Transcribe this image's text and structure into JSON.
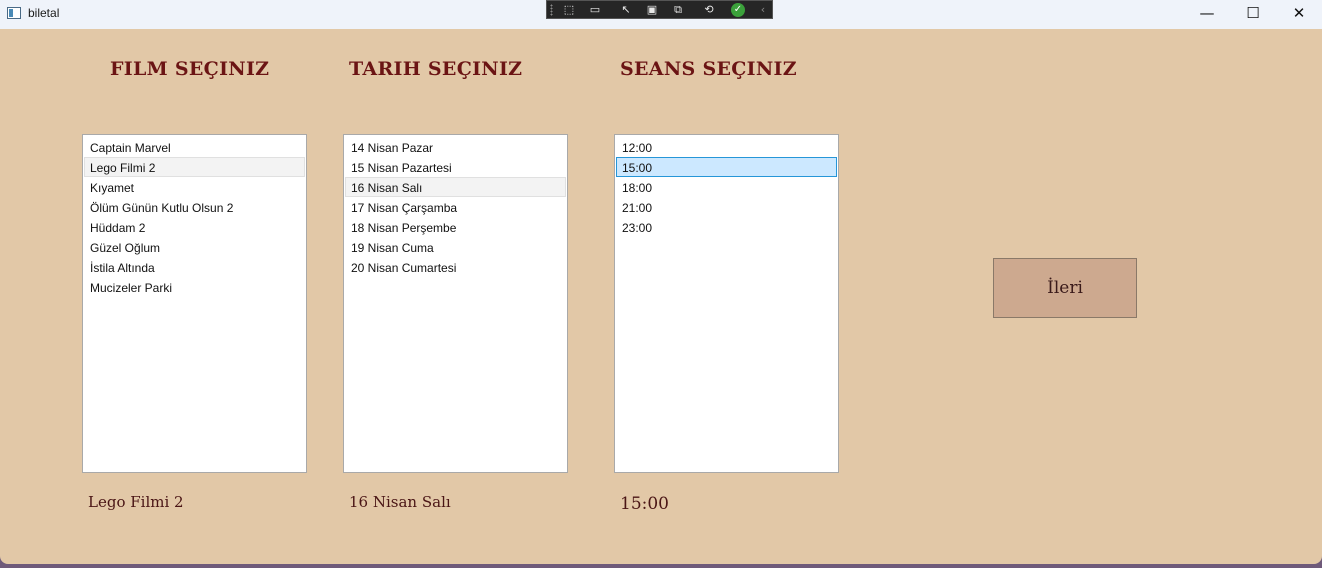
{
  "window": {
    "title": "biletal",
    "controls": {
      "minimize": "—",
      "maximize": "☐",
      "close": "✕"
    }
  },
  "debug_toolbar": {
    "icons": [
      "select-element-icon",
      "record-icon",
      "pointer-select-icon",
      "focus-rect-icon",
      "hot-reload-icon",
      "binding-failures-icon",
      "ok-check-icon",
      "collapse-icon"
    ]
  },
  "colors": {
    "background": "#e2c8a7",
    "heading": "#6b1414",
    "button": "#cda98f",
    "selected_item": "#cce8ff"
  },
  "film": {
    "heading": "FILM SEÇINIZ",
    "items": [
      "Captain Marvel",
      "Lego Filmi 2",
      "Kıyamet",
      "Ölüm Günün Kutlu Olsun 2",
      "Hüddam 2",
      "Güzel Oğlum",
      "İstila Altında",
      "Mucizeler Parki"
    ],
    "selected": "Lego Filmi 2"
  },
  "date": {
    "heading": "TARIH SEÇINIZ",
    "items": [
      "14 Nisan Pazar",
      "15 Nisan Pazartesi",
      "16 Nisan Salı",
      "17 Nisan Çarşamba",
      "18 Nisan Perşembe",
      "19 Nisan Cuma",
      "20 Nisan Cumartesi"
    ],
    "selected": "16 Nisan Salı"
  },
  "session": {
    "heading": "SEANS SEÇINIZ",
    "items": [
      "12:00",
      "15:00",
      "18:00",
      "21:00",
      "23:00"
    ],
    "selected": "15:00"
  },
  "next_button": {
    "label": "İleri"
  }
}
